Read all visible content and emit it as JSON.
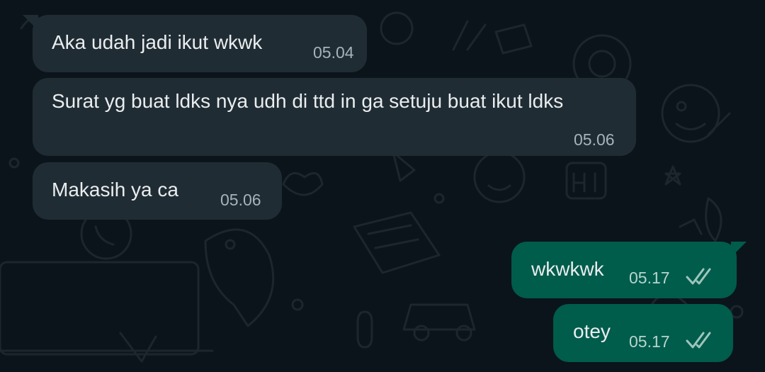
{
  "colors": {
    "background": "#0b141a",
    "incoming_bubble": "#202c33",
    "outgoing_bubble": "#005c4b",
    "read_ticks": "#9ec5bc"
  },
  "messages": [
    {
      "direction": "incoming",
      "text": "Aka udah jadi ikut wkwk",
      "time": "05.04"
    },
    {
      "direction": "incoming",
      "text": "Surat yg buat ldks nya udh di ttd in ga setuju buat ikut ldks",
      "time": "05.06"
    },
    {
      "direction": "incoming",
      "text": "Makasih ya ca",
      "time": "05.06"
    },
    {
      "direction": "outgoing",
      "text": "wkwkwk",
      "time": "05.17",
      "status_icon": "double-check-icon"
    },
    {
      "direction": "outgoing",
      "text": "otey",
      "time": "05.17",
      "status_icon": "double-check-icon"
    }
  ]
}
